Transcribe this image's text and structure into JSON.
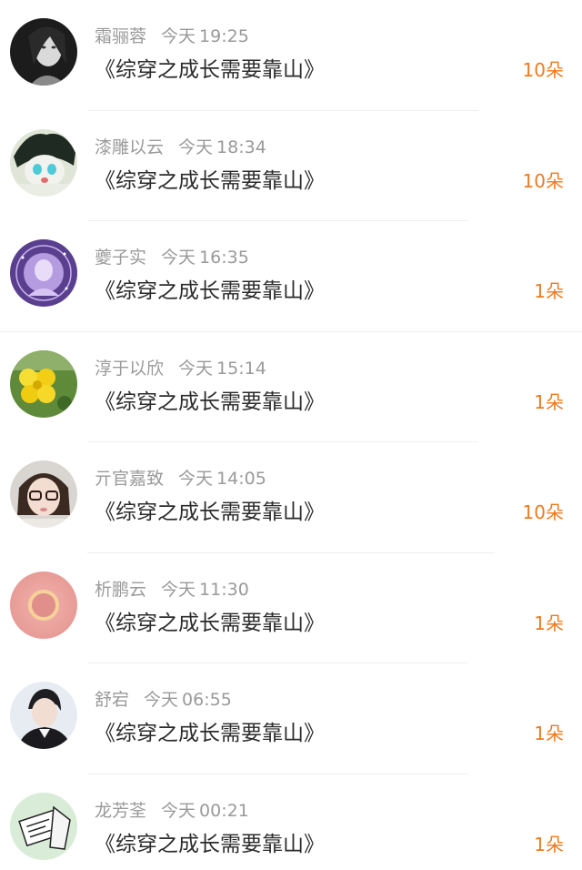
{
  "rows": [
    {
      "name": "霜骊蓉",
      "day": "今天",
      "time": "19:25",
      "title": "《综穿之成长需要靠山》",
      "gift": "10朵",
      "avatar": "grayscale-girl-portrait"
    },
    {
      "name": "漆雕以云",
      "day": "今天",
      "time": "18:34",
      "title": "《综穿之成长需要靠山》",
      "gift": "10朵",
      "avatar": "anime-cat-character"
    },
    {
      "name": "夔子实",
      "day": "今天",
      "time": "16:35",
      "title": "《综穿之成长需要靠山》",
      "gift": "1朵",
      "avatar": "purple-zodiac-circle"
    },
    {
      "name": "淳于以欣",
      "day": "今天",
      "time": "15:14",
      "title": "《综穿之成长需要靠山》",
      "gift": "1朵",
      "avatar": "yellow-flower"
    },
    {
      "name": "亓官嘉致",
      "day": "今天",
      "time": "14:05",
      "title": "《综穿之成长需要靠山》",
      "gift": "10朵",
      "avatar": "girl-with-glasses"
    },
    {
      "name": "析鹏云",
      "day": "今天",
      "time": "11:30",
      "title": "《综穿之成长需要靠山》",
      "gift": "1朵",
      "avatar": "pink-solar-eclipse"
    },
    {
      "name": "舒宕",
      "day": "今天",
      "time": "06:55",
      "title": "《综穿之成长需要靠山》",
      "gift": "1朵",
      "avatar": "boy-portrait"
    },
    {
      "name": "龙芳荃",
      "day": "今天",
      "time": "00:21",
      "title": "《综穿之成长需要靠山》",
      "gift": "1朵",
      "avatar": "sketch-card"
    }
  ],
  "colors": {
    "gift": "#f07a1e",
    "meta": "#9a9a9a",
    "title": "#2b2b2b",
    "divider": "#efefef"
  }
}
